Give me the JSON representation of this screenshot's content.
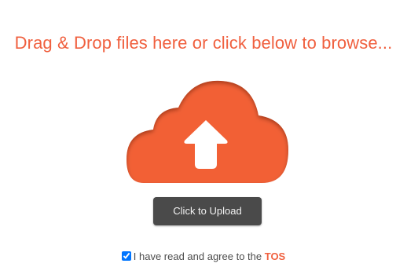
{
  "dropzone": {
    "headline": "Drag & Drop files here or click below to browse..."
  },
  "icons": {
    "cloud": "cloud-upload-icon",
    "arrow": "arrow-up-icon"
  },
  "upload_button": {
    "label": "Click to Upload"
  },
  "tos": {
    "checked": true,
    "text": "I have read and agree to the ",
    "link": "TOS"
  },
  "colors": {
    "accent": "#f0603f",
    "cloud_fill": "#f26136",
    "button_bg": "#4a4a4a",
    "button_text": "#f2f2f2"
  }
}
